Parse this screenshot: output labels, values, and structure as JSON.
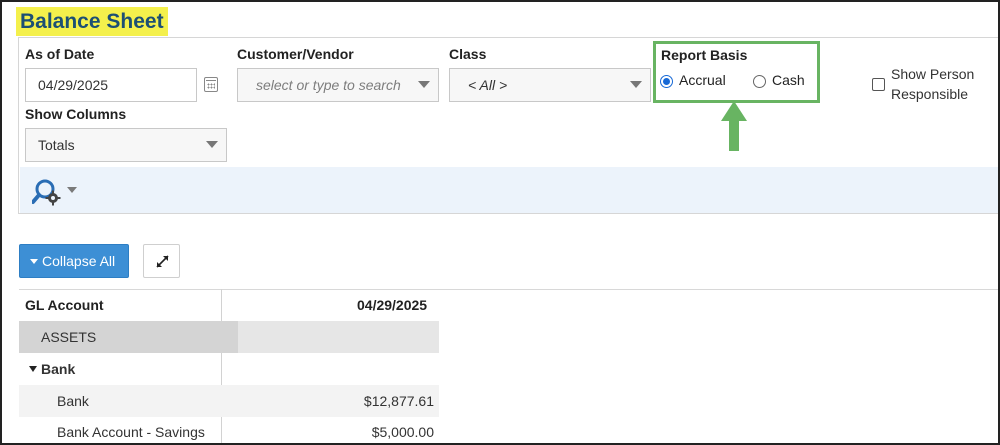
{
  "page": {
    "title": "Balance Sheet"
  },
  "filters": {
    "as_of_date": {
      "label": "As of Date",
      "value": "04/29/2025"
    },
    "customer_vendor": {
      "label": "Customer/Vendor",
      "placeholder": "select or type to search"
    },
    "class": {
      "label": "Class",
      "value": "< All >"
    },
    "report_basis": {
      "label": "Report Basis",
      "options": [
        "Accrual",
        "Cash"
      ],
      "selected": "Accrual"
    },
    "show_person_responsible": {
      "label_line1": "Show Person",
      "label_line2": "Responsible",
      "checked": false
    },
    "show_columns": {
      "label": "Show Columns",
      "value": "Totals"
    }
  },
  "toolbar": {
    "search_icon": "search-settings-icon"
  },
  "actions": {
    "collapse_all": "Collapse All",
    "expand_icon": "expand-arrows-icon"
  },
  "table": {
    "columns": [
      "GL Account",
      "04/29/2025"
    ],
    "rows": [
      {
        "name": "ASSETS",
        "amount": ""
      },
      {
        "name": "Bank",
        "amount": ""
      },
      {
        "name": "Bank",
        "amount": "$12,877.61"
      },
      {
        "name": "Bank Account - Savings",
        "amount": "$5,000.00"
      }
    ]
  },
  "colors": {
    "title_highlight": "#f4f04c",
    "title_text": "#1c4f74",
    "highlight_box": "#68b462",
    "primary_button": "#3d8fd5",
    "toolbar_bg": "#ecf3fb"
  }
}
